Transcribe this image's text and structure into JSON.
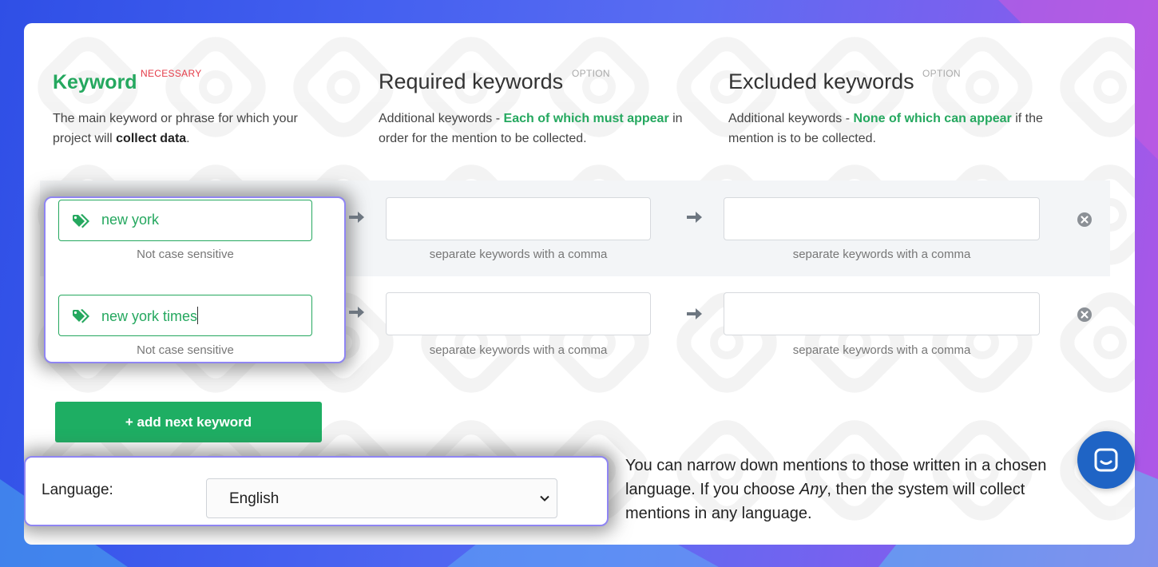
{
  "columns": {
    "keyword": {
      "title": "Keyword",
      "badge": "NECESSARY",
      "desc_part1": "The main keyword or phrase for which your project will ",
      "desc_bold": "collect data",
      "desc_part2": "."
    },
    "required": {
      "title": "Required keywords",
      "badge": "OPTION",
      "desc_part1": "Additional keywords - ",
      "desc_green": "Each of which must appear",
      "desc_part2": " in order for the mention to be collected."
    },
    "excluded": {
      "title": "Excluded keywords",
      "badge": "OPTION",
      "desc_part1": "Additional keywords - ",
      "desc_green": "None of which can appear",
      "desc_part2": " if the mention is to be collected."
    }
  },
  "rows": [
    {
      "keyword": "new york",
      "keyword_hint": "Not case sensitive",
      "required_value": "",
      "required_hint": "separate keywords with a comma",
      "excluded_value": "",
      "excluded_hint": "separate keywords with a comma"
    },
    {
      "keyword": "new york times",
      "keyword_hint": "Not case sensitive",
      "required_value": "",
      "required_hint": "separate keywords with a comma",
      "excluded_value": "",
      "excluded_hint": "separate keywords with a comma"
    }
  ],
  "add_button": "+ add next keyword",
  "language": {
    "label": "Language:",
    "selected": "English",
    "help_part1": "You can narrow down mentions to those written in a chosen language. If you choose ",
    "help_italic": "Any",
    "help_part2": ", then the system will collect mentions in any language."
  },
  "colors": {
    "accent_green": "#25a85f",
    "button_green": "#1eae63",
    "necessary_red": "#e43b48",
    "highlight_border": "#8f85f3",
    "chat_blue": "#1f64c5"
  },
  "icons": [
    "tag-icon",
    "arrow-right-icon",
    "remove-circle-icon",
    "chevron-down-icon",
    "chat-icon"
  ]
}
